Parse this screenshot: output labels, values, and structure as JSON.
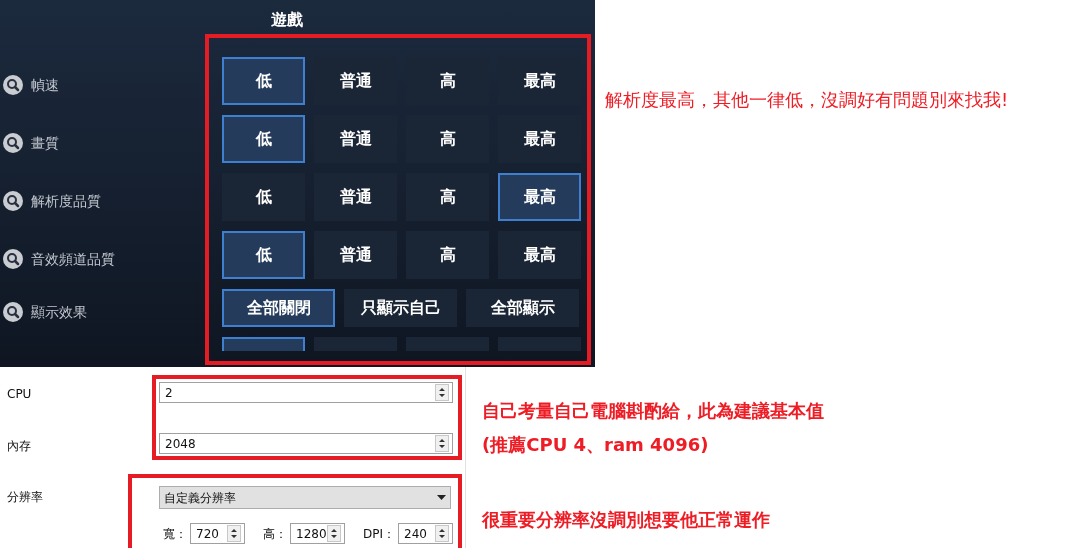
{
  "game_panel": {
    "title": "遊戲",
    "settings": [
      {
        "label": "幀速",
        "options": [
          {
            "label": "低",
            "selected": true
          },
          {
            "label": "普通",
            "selected": false
          },
          {
            "label": "高",
            "selected": false
          },
          {
            "label": "最高",
            "selected": false
          }
        ]
      },
      {
        "label": "畫質",
        "options": [
          {
            "label": "低",
            "selected": true
          },
          {
            "label": "普通",
            "selected": false
          },
          {
            "label": "高",
            "selected": false
          },
          {
            "label": "最高",
            "selected": false
          }
        ]
      },
      {
        "label": "解析度品質",
        "options": [
          {
            "label": "低",
            "selected": false
          },
          {
            "label": "普通",
            "selected": false
          },
          {
            "label": "高",
            "selected": false
          },
          {
            "label": "最高",
            "selected": true
          }
        ]
      },
      {
        "label": "音效頻道品質",
        "options": [
          {
            "label": "低",
            "selected": true
          },
          {
            "label": "普通",
            "selected": false
          },
          {
            "label": "高",
            "selected": false
          },
          {
            "label": "最高",
            "selected": false
          }
        ]
      },
      {
        "label": "顯示效果",
        "options": [
          {
            "label": "全部關閉",
            "selected": true
          },
          {
            "label": "只顯示自己",
            "selected": false
          },
          {
            "label": "全部顯示",
            "selected": false
          }
        ]
      }
    ],
    "clipped_row": [
      {
        "selected": true
      },
      {
        "selected": false
      },
      {
        "selected": false
      },
      {
        "selected": false
      }
    ]
  },
  "game_note": "解析度最高，其他一律低，沒調好有問題別來找我!",
  "emulator_settings": {
    "cpu": {
      "label": "CPU",
      "value": "2"
    },
    "memory": {
      "label": "內存",
      "value": "2048"
    },
    "resolution": {
      "label": "分辨率",
      "value": "自定義分辨率",
      "fields": [
        {
          "label": "寬：",
          "value": "720"
        },
        {
          "label": "高：",
          "value": "1280"
        },
        {
          "label": "DPI：",
          "value": "240"
        }
      ]
    }
  },
  "hardware_note": [
    "自己考量自己電腦斟酌給，此為建議基本值",
    "(推薦CPU 4、ram 4096)"
  ],
  "resolution_note": "很重要分辨率沒調別想要他正常運作"
}
